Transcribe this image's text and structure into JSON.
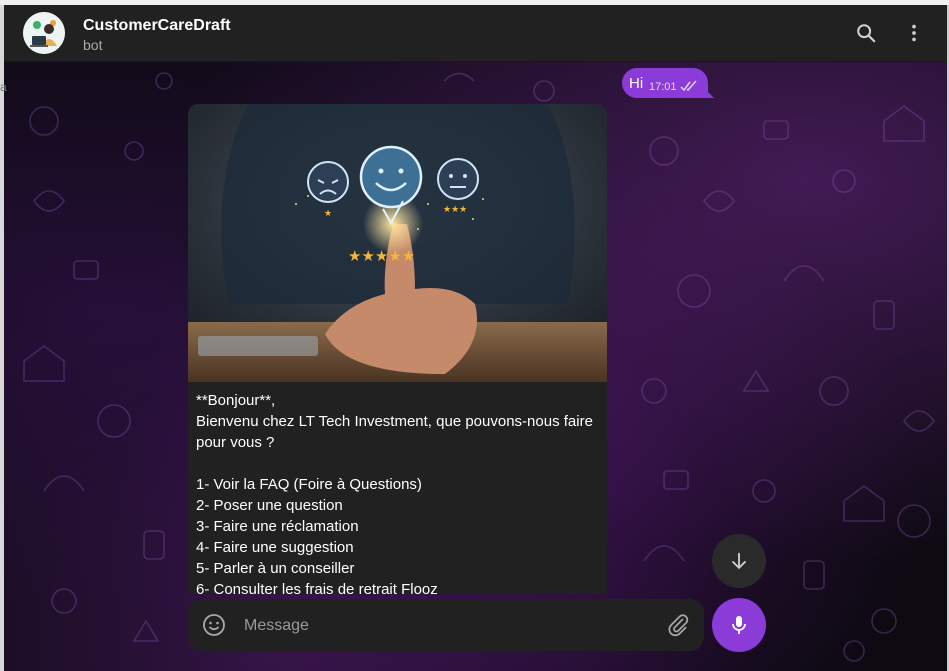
{
  "header": {
    "title": "CustomerCareDraft",
    "subtitle": "bot"
  },
  "outgoing": {
    "text": "Hi",
    "time": "17:01",
    "status": "read"
  },
  "incoming": {
    "image": "customer-satisfaction-photo",
    "text": "**Bonjour**,\nBienvenu chez LT Tech Investment, que pouvons-nous faire pour vous ?\n\n1- Voir la FAQ (Foire à Questions)\n2- Poser une question\n3- Faire une réclamation\n4- Faire une suggestion\n5- Parler à un conseiller\n6- Consulter les frais de retrait Flooz"
  },
  "composer": {
    "placeholder": "Message"
  },
  "icons": {
    "search": "search-icon",
    "menu": "more-vertical-icon",
    "emoji": "emoji-icon",
    "attach": "paperclip-icon",
    "mic": "microphone-icon",
    "scroll": "arrow-down-icon",
    "ticks": "double-check-icon"
  },
  "colors": {
    "accent": "#8a3bd8",
    "header_bg": "#212121",
    "bubble_in_bg": "#212121"
  }
}
